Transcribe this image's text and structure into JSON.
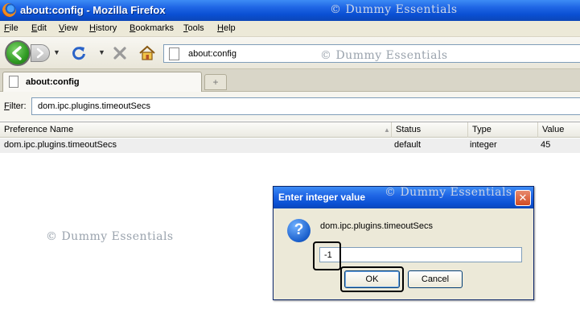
{
  "window": {
    "title": "about:config - Mozilla Firefox",
    "watermark": "© Dummy Essentials"
  },
  "menu": {
    "items": [
      "File",
      "Edit",
      "View",
      "History",
      "Bookmarks",
      "Tools",
      "Help"
    ]
  },
  "navbar": {
    "url": "about:config"
  },
  "tab": {
    "label": "about:config",
    "new_tab_symbol": "+"
  },
  "filter": {
    "label": "Filter:",
    "value": "dom.ipc.plugins.timeoutSecs"
  },
  "tree": {
    "columns": [
      "Preference Name",
      "Status",
      "Type",
      "Value"
    ],
    "rows": [
      {
        "name": "dom.ipc.plugins.timeoutSecs",
        "status": "default",
        "type": "integer",
        "value": "45"
      }
    ]
  },
  "dialog": {
    "title": "Enter integer value",
    "message": "dom.ipc.plugins.timeoutSecs",
    "input_value": "-1",
    "ok_label": "OK",
    "cancel_label": "Cancel",
    "close_symbol": "✕"
  },
  "colors": {
    "titlebar_blue": "#0a4fd2",
    "chrome_beige": "#ece9d8",
    "row_selected": "#eeeeee",
    "close_red": "#d14b24",
    "watermark_gray": "#9aa3ad"
  },
  "icons": [
    "firefox-logo-icon",
    "back-arrow-icon",
    "forward-arrow-icon",
    "reload-icon",
    "stop-icon",
    "home-icon",
    "page-icon",
    "question-icon",
    "close-icon"
  ]
}
